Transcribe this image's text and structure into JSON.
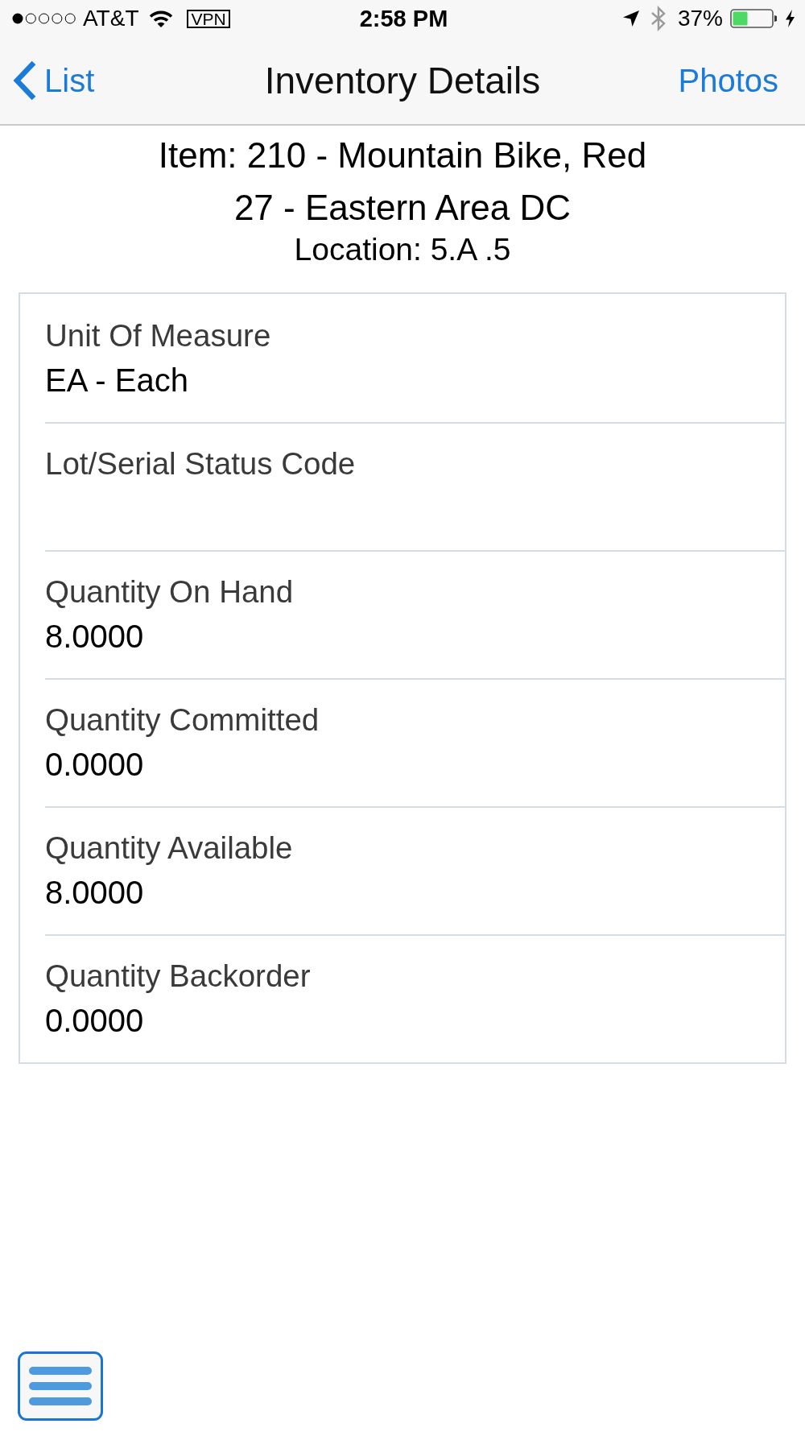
{
  "status_bar": {
    "carrier": "AT&T",
    "vpn": "VPN",
    "time": "2:58 PM",
    "battery_percent": "37%",
    "charging": true
  },
  "nav": {
    "back": "List",
    "title": "Inventory Details",
    "action": "Photos"
  },
  "header": {
    "item": "Item: 210 - Mountain Bike, Red",
    "branch": "27 - Eastern Area DC",
    "location": "Location: 5.A .5"
  },
  "fields": [
    {
      "label": "Unit Of Measure",
      "value": "EA - Each"
    },
    {
      "label": "Lot/Serial Status Code"
    },
    {
      "label": "Quantity On Hand",
      "value": "8.0000"
    },
    {
      "label": "Quantity Committed",
      "value": "0.0000"
    },
    {
      "label": "Quantity Available",
      "value": "8.0000"
    },
    {
      "label": "Quantity Backorder",
      "value": "0.0000"
    }
  ]
}
